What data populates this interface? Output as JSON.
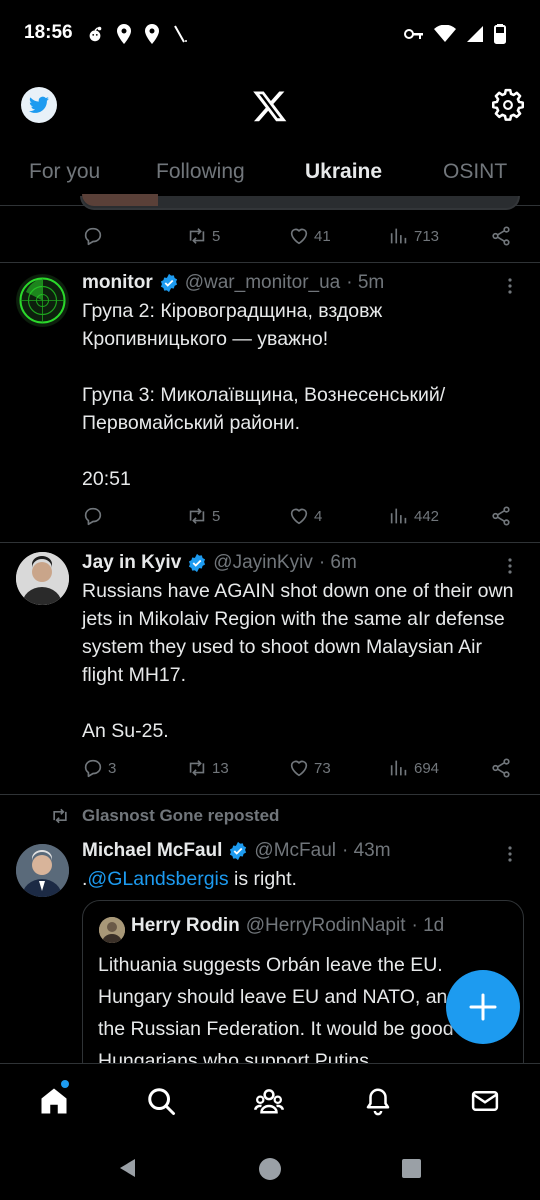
{
  "status_bar": {
    "time": "18:56"
  },
  "tabs": [
    {
      "label": "For you",
      "active": false
    },
    {
      "label": "Following",
      "active": false
    },
    {
      "label": "Ukraine",
      "active": true
    },
    {
      "label": "OSINT",
      "active": false
    }
  ],
  "colors": {
    "accent": "#1d9bf0",
    "background": "#000000",
    "text": "#e7e9ea",
    "muted": "#71767b",
    "divider": "#2f3336"
  },
  "prev_post": {
    "reposts": "5",
    "likes": "41",
    "views": "713"
  },
  "posts": [
    {
      "name": "monitor",
      "handle": "@war_monitor_ua",
      "time": "· 5m",
      "paragraphs": [
        "Група 2: Кіровоградщина, вздовж Кропивницького — уважно!",
        "Група 3: Миколаївщина, Вознесенський/ Первомайський райони.",
        "20:51"
      ],
      "replies": "",
      "reposts": "5",
      "likes": "4",
      "views": "442"
    },
    {
      "name": "Jay in Kyiv",
      "handle": "@JayinKyiv",
      "time": "· 6m",
      "paragraphs": [
        "Russians have AGAIN shot down one of their own jets in Mikolaiv Region with the same aIr defense system they used to shoot down Malaysian Air flight MH17.",
        "An Su-25."
      ],
      "replies": "3",
      "reposts": "13",
      "likes": "73",
      "views": "694"
    },
    {
      "repost_by": "Glasnost Gone reposted",
      "name": "Michael McFaul",
      "handle": "@McFaul",
      "time": "· 43m",
      "text_prefix": ".",
      "mention": "@GLandsbergis",
      "text_suffix": " is right.",
      "quote": {
        "name": "Herry Rodin",
        "handle": "@HerryRodinNapit",
        "time": "· 1d",
        "text": "Lithuania suggests Orbán leave the EU. Hungary should leave EU and NATO, and join the Russian Federation. It would be good for Hungarians who support Putins"
      }
    }
  ],
  "nav": [
    "home-icon",
    "search-icon",
    "communities-icon",
    "notifications-icon",
    "messages-icon"
  ]
}
